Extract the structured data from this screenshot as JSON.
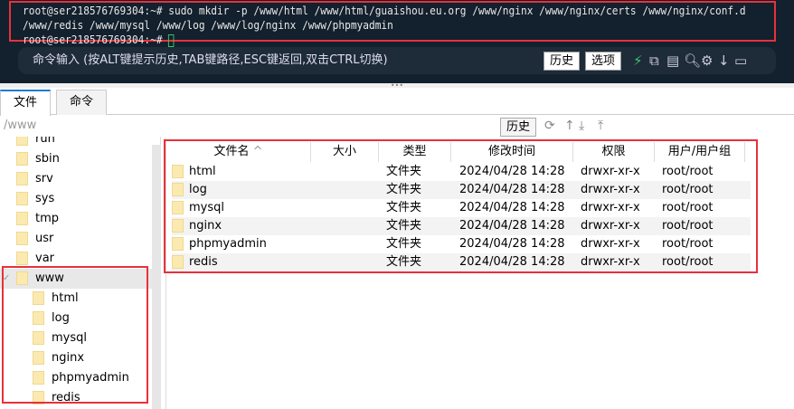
{
  "terminal": {
    "lines": [
      "root@ser218576769304:~# sudo mkdir -p /www/html /www/html/guaishou.eu.org /www/nginx /www/nginx/certs /www/nginx/conf.d",
      "/www/redis /www/mysql /www/log /www/log/nginx /www/phpmyadmin",
      "root@ser218576769304:~# "
    ]
  },
  "cmdbar": {
    "hint": "命令输入 (按ALT键提示历史,TAB键路径,ESC键返回,双击CTRL切换)",
    "history": "历史",
    "options": "选项"
  },
  "tabs": [
    {
      "label": "文件"
    },
    {
      "label": "命令"
    }
  ],
  "path": {
    "value": "/www",
    "history": "历史"
  },
  "tree": [
    "run",
    "sbin",
    "srv",
    "sys",
    "tmp",
    "usr",
    "var",
    "www",
    "html",
    "log",
    "mysql",
    "nginx",
    "phpmyadmin",
    "redis"
  ],
  "list": {
    "headers": [
      "文件名",
      "大小",
      "类型",
      "修改时间",
      "权限",
      "用户/用户组"
    ],
    "sort_indicator": "^",
    "rows": [
      {
        "name": "html",
        "type": "文件夹",
        "mtime": "2024/04/28 14:28",
        "perm": "drwxr-xr-x",
        "owner": "root/root"
      },
      {
        "name": "log",
        "type": "文件夹",
        "mtime": "2024/04/28 14:28",
        "perm": "drwxr-xr-x",
        "owner": "root/root"
      },
      {
        "name": "mysql",
        "type": "文件夹",
        "mtime": "2024/04/28 14:28",
        "perm": "drwxr-xr-x",
        "owner": "root/root"
      },
      {
        "name": "nginx",
        "type": "文件夹",
        "mtime": "2024/04/28 14:28",
        "perm": "drwxr-xr-x",
        "owner": "root/root"
      },
      {
        "name": "phpmyadmin",
        "type": "文件夹",
        "mtime": "2024/04/28 14:28",
        "perm": "drwxr-xr-x",
        "owner": "root/root"
      },
      {
        "name": "redis",
        "type": "文件夹",
        "mtime": "2024/04/28 14:28",
        "perm": "drwxr-xr-x",
        "owner": "root/root"
      }
    ]
  },
  "colors": {
    "terminal_bg": "#13202d",
    "highlight": "#e8313a",
    "tab_accent": "#1e7bd7"
  }
}
